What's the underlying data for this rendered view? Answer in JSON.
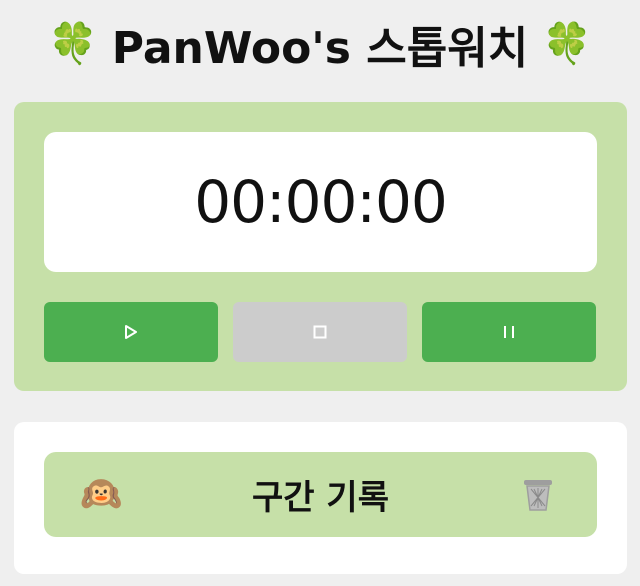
{
  "header": {
    "title": "PanWoo's 스톱워치",
    "left_icon": "🍀",
    "right_icon": "🍀"
  },
  "timer": {
    "display": "00:00:00"
  },
  "controls": {
    "start_icon": "play-icon",
    "stop_icon": "stop-icon",
    "pause_icon": "pause-icon"
  },
  "laps": {
    "title": "구간 기록",
    "monkey_icon": "🙉",
    "trash_icon": "wastebasket-icon"
  },
  "colors": {
    "background": "#efefef",
    "card_green": "#c6e0a8",
    "button_green": "#4caf50",
    "button_gray": "#cccccc"
  }
}
